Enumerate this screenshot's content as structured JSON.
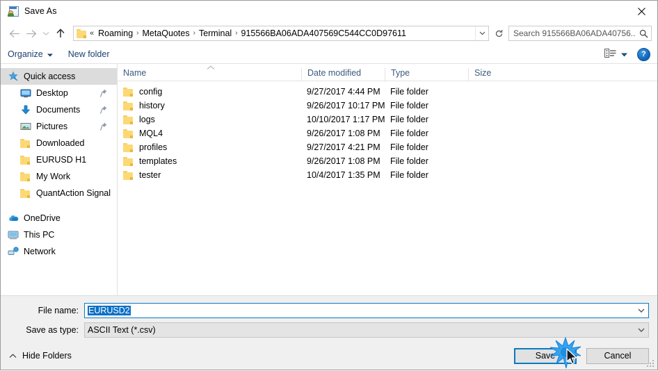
{
  "window": {
    "title": "Save As",
    "icon": "save-as-app-icon",
    "close_label": "✕"
  },
  "nav": {
    "back_icon": "arrow-left-icon",
    "forward_icon": "arrow-right-icon",
    "recent_icon": "chevron-down-icon",
    "up_icon": "arrow-up-icon",
    "address": {
      "folder_icon": "folder-icon",
      "prefix": "«",
      "crumbs": [
        "Roaming",
        "MetaQuotes",
        "Terminal",
        "915566BA06ADA407569C544CC0D97611"
      ],
      "separator": "›",
      "dropdown_icon": "chevron-down-icon",
      "refresh_icon": "refresh-icon"
    },
    "search": {
      "placeholder": "Search 915566BA06ADA40756...",
      "icon": "search-icon"
    }
  },
  "toolbar": {
    "organize_label": "Organize",
    "organize_caret": "▾",
    "new_folder_label": "New folder",
    "view_icon": "list-view-icon",
    "view_caret": "▾",
    "help_label": "?",
    "help_icon": "help-icon"
  },
  "sidebar": {
    "items": [
      {
        "label": "Quick access",
        "icon": "star-pin-icon",
        "level": "root",
        "selected": true,
        "pinned": false
      },
      {
        "label": "Desktop",
        "icon": "desktop-icon",
        "level": "child",
        "selected": false,
        "pinned": true
      },
      {
        "label": "Documents",
        "icon": "documents-download-icon",
        "level": "child",
        "selected": false,
        "pinned": true
      },
      {
        "label": "Pictures",
        "icon": "pictures-icon",
        "level": "child",
        "selected": false,
        "pinned": true
      },
      {
        "label": "Downloaded",
        "icon": "folder-icon",
        "level": "child",
        "selected": false,
        "pinned": false
      },
      {
        "label": "EURUSD H1",
        "icon": "folder-icon",
        "level": "child",
        "selected": false,
        "pinned": false
      },
      {
        "label": "My Work",
        "icon": "folder-icon",
        "level": "child",
        "selected": false,
        "pinned": false
      },
      {
        "label": "QuantAction Signal",
        "icon": "folder-icon",
        "level": "child",
        "selected": false,
        "pinned": false
      }
    ],
    "roots": [
      {
        "label": "OneDrive",
        "icon": "onedrive-cloud-icon"
      },
      {
        "label": "This PC",
        "icon": "this-pc-icon"
      },
      {
        "label": "Network",
        "icon": "network-icon"
      }
    ]
  },
  "filelist": {
    "columns": [
      "Name",
      "Date modified",
      "Type",
      "Size"
    ],
    "sort_indicator": "⌃",
    "rows": [
      {
        "name": "config",
        "date": "9/27/2017 4:44 PM",
        "type": "File folder",
        "size": "",
        "icon": "folder-icon"
      },
      {
        "name": "history",
        "date": "9/26/2017 10:17 PM",
        "type": "File folder",
        "size": "",
        "icon": "folder-icon"
      },
      {
        "name": "logs",
        "date": "10/10/2017 1:17 PM",
        "type": "File folder",
        "size": "",
        "icon": "folder-icon"
      },
      {
        "name": "MQL4",
        "date": "9/26/2017 1:08 PM",
        "type": "File folder",
        "size": "",
        "icon": "folder-icon"
      },
      {
        "name": "profiles",
        "date": "9/27/2017 4:21 PM",
        "type": "File folder",
        "size": "",
        "icon": "folder-icon"
      },
      {
        "name": "templates",
        "date": "9/26/2017 1:08 PM",
        "type": "File folder",
        "size": "",
        "icon": "folder-icon"
      },
      {
        "name": "tester",
        "date": "10/4/2017 1:35 PM",
        "type": "File folder",
        "size": "",
        "icon": "folder-icon"
      }
    ]
  },
  "form": {
    "filename_label": "File name:",
    "filename_value": "EURUSD2",
    "filetype_label": "Save as type:",
    "filetype_value": "ASCII Text (*.csv)",
    "dropdown_icon": "chevron-down-icon"
  },
  "footer": {
    "hide_folders_label": "Hide Folders",
    "hide_folders_icon": "chevron-up-icon",
    "save_label": "Save",
    "cancel_label": "Cancel",
    "resize_grip_icon": "resize-grip-icon",
    "click_indicator_icon": "click-burst-icon",
    "cursor_icon": "mouse-pointer-icon"
  },
  "colors": {
    "accent": "#0a7ac0",
    "selection": "#0b6fc4",
    "folder": "#fcd975",
    "header_text": "#3c5a80",
    "toolbar_text": "#1b3f72"
  }
}
